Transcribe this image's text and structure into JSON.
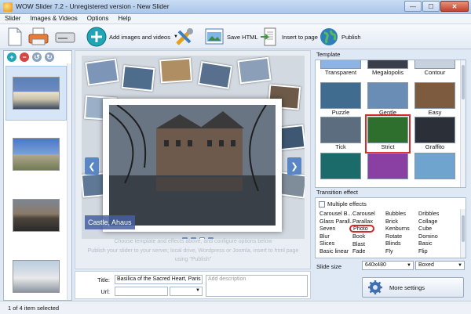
{
  "window": {
    "title": "WOW Slider 7.2 - Unregistered version - New Slider"
  },
  "menu": [
    "Slider",
    "Images & Videos",
    "Options",
    "Help"
  ],
  "toolbar": {
    "add_label": "Add images and videos",
    "save_html_label": "Save HTML",
    "insert_label": "Insert to page",
    "publish_label": "Publish"
  },
  "preview": {
    "caption": "Castle, Ahaus",
    "hint_line1": "Choose template and effects above, and configure options below",
    "hint_line2": "Publish your slider to your server, local drive, Wordpress or Joomla, insert to html page",
    "hint_line3": "using \"Publish\""
  },
  "fields": {
    "title_label": "Title:",
    "title_value": "Basilica of the Sacred Heart, Paris",
    "url_label": "Url:",
    "description_placeholder": "Add description"
  },
  "status": {
    "text": "1 of 4 item selected"
  },
  "templates": {
    "section_title": "Template",
    "items": [
      {
        "name": "Transparent",
        "color": "#8bb3e3"
      },
      {
        "name": "Megalopolis",
        "color": "#3a3f4a"
      },
      {
        "name": "Contour",
        "color": "#c8d2de"
      },
      {
        "name": "Puzzle",
        "color": "#3f6c8f"
      },
      {
        "name": "Gentle",
        "color": "#6a8db5"
      },
      {
        "name": "Easy",
        "color": "#7c5b3e"
      },
      {
        "name": "Tick",
        "color": "#5d6d80"
      },
      {
        "name": "Strict",
        "color": "#2f6f2e"
      },
      {
        "name": "Graffito",
        "color": "#2b2f38"
      },
      {
        "name": "",
        "color": "#1c6b6b"
      },
      {
        "name": "",
        "color": "#8a3fa2"
      },
      {
        "name": "",
        "color": "#6fa4cf"
      }
    ]
  },
  "effects": {
    "section_title": "Transition effect",
    "multiple_label": "Multiple effects",
    "columns": [
      [
        "Carousel B...",
        "Glass Parall...",
        "Seven",
        "Blur",
        "Slices",
        "Basic linear"
      ],
      [
        "Carousel",
        "Parallax",
        "Photo",
        "Book",
        "Blast",
        "Fade"
      ],
      [
        "Bubbles",
        "Brick",
        "Kenburns",
        "Rotate",
        "Blinds",
        "Fly"
      ],
      [
        "Dribbles",
        "Collage",
        "Cube",
        "Domino",
        "Basic",
        "Flip"
      ]
    ]
  },
  "slide_size": {
    "label": "Slide size",
    "size_value": "640x480",
    "mode_value": "Boxed"
  },
  "more_settings_label": "More settings"
}
